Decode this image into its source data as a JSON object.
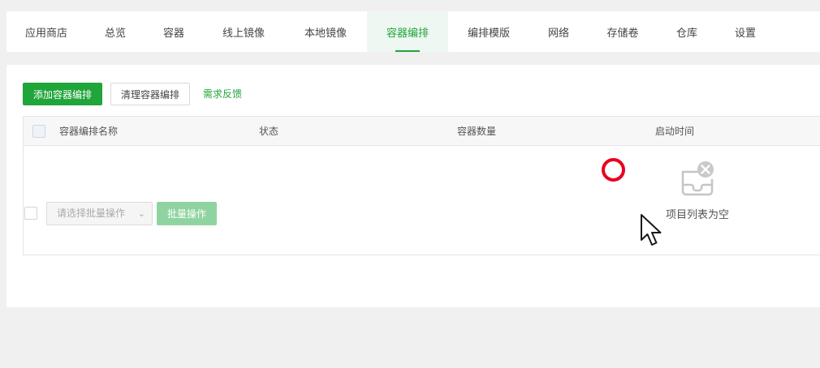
{
  "tabs": [
    {
      "label": "应用商店",
      "active": false
    },
    {
      "label": "总览",
      "active": false
    },
    {
      "label": "容器",
      "active": false
    },
    {
      "label": "线上镜像",
      "active": false
    },
    {
      "label": "本地镜像",
      "active": false
    },
    {
      "label": "容器编排",
      "active": true
    },
    {
      "label": "编排模版",
      "active": false
    },
    {
      "label": "网络",
      "active": false
    },
    {
      "label": "存储卷",
      "active": false
    },
    {
      "label": "仓库",
      "active": false
    },
    {
      "label": "设置",
      "active": false
    }
  ],
  "toolbar": {
    "add_label": "添加容器编排",
    "clean_label": "清理容器编排",
    "feedback_label": "需求反馈"
  },
  "table": {
    "columns": [
      "容器编排名称",
      "状态",
      "容器数量",
      "启动时间"
    ],
    "rows": [],
    "empty_text": "项目列表为空"
  },
  "footer": {
    "batch_select_placeholder": "请选择批量操作",
    "batch_button_label": "批量操作"
  },
  "colors": {
    "accent": "#20a53a",
    "accent_disabled": "#8fd4a0",
    "active_tab_bg": "#eef7f2",
    "click_marker": "#e8001e",
    "page_bg": "#f0f0f0"
  },
  "icons": {
    "empty_state": "empty-inbox-icon",
    "select_arrow": "chevron-down-icon",
    "cursor": "mouse-pointer-icon"
  }
}
